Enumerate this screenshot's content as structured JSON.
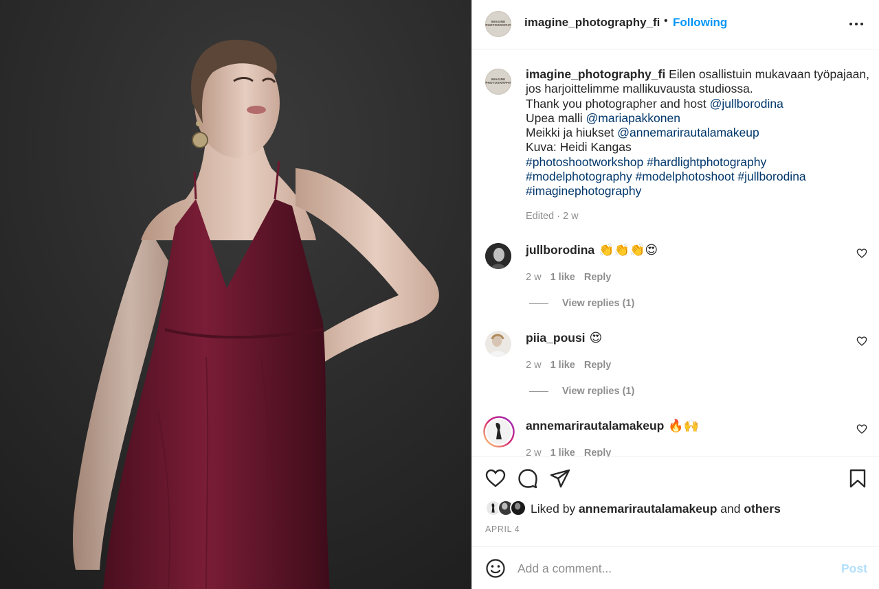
{
  "photo": {
    "alt_subject": ""
  },
  "header": {
    "avatar_text": "IMAGINE PHOTOGRAPHY",
    "username": "imagine_photography_fi",
    "separator": "•",
    "follow_status": "Following",
    "more_icon": "more-horizontal-icon"
  },
  "caption": {
    "username": "imagine_photography_fi",
    "line1": "Eilen osallistuin mukavaan työpajaan, jos harjoittelimme mallikuvausta studiossa.",
    "line2_text": "Thank you photographer and host ",
    "line2_link": "@jullborodina",
    "line3_text": "Upea malli ",
    "line3_link": "@mariapakkonen",
    "line4_text": "Meikki ja hiukset ",
    "line4_link": "@annemarirautalamakeup",
    "line5": "Kuva: Heidi Kangas",
    "hashtags1": "#photoshootworkshop #hardlightphotography",
    "hashtags2": "#modelphotography #modelphotoshoot #jullborodina",
    "hashtags3": "#imaginephotography",
    "edited": "Edited · 2 w"
  },
  "comments": [
    {
      "username": "jullborodina",
      "text": "👏👏👏😍",
      "time": "2 w",
      "likes": "1 like",
      "reply": "Reply",
      "view_replies": "View replies (1)"
    },
    {
      "username": "piia_pousi",
      "text": "😍",
      "time": "2 w",
      "likes": "1 like",
      "reply": "Reply",
      "view_replies": "View replies (1)"
    },
    {
      "username": "annemarirautalamakeup",
      "text": "🔥🙌",
      "time": "2 w",
      "likes": "1 like",
      "reply": "Reply"
    }
  ],
  "actions": {
    "like_icon": "heart-icon",
    "comment_icon": "comment-icon",
    "share_icon": "send-icon",
    "save_icon": "bookmark-icon",
    "liked_prefix": "Liked by ",
    "liked_user": "annemarirautalamakeup",
    "liked_and": " and ",
    "liked_others": "others",
    "date": "APRIL 4"
  },
  "add_comment": {
    "placeholder": "Add a comment...",
    "post_label": "Post",
    "emoji_icon": "smiley-icon"
  },
  "colors": {
    "link": "#00376b",
    "follow": "#0095f6",
    "post_disabled": "#b2dffc",
    "muted": "#8e8e8e",
    "dress": "#6e1a30"
  }
}
